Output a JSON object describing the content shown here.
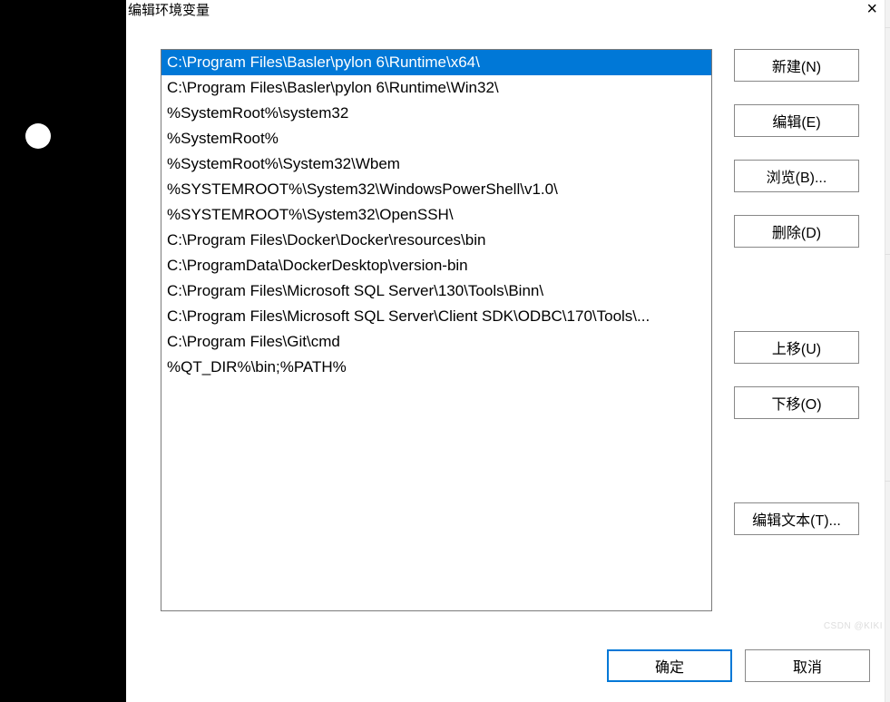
{
  "dialog": {
    "title": "编辑环境变量",
    "close_label": "×"
  },
  "paths": [
    "C:\\Program Files\\Basler\\pylon 6\\Runtime\\x64\\",
    "C:\\Program Files\\Basler\\pylon 6\\Runtime\\Win32\\",
    "%SystemRoot%\\system32",
    "%SystemRoot%",
    "%SystemRoot%\\System32\\Wbem",
    "%SYSTEMROOT%\\System32\\WindowsPowerShell\\v1.0\\",
    "%SYSTEMROOT%\\System32\\OpenSSH\\",
    "C:\\Program Files\\Docker\\Docker\\resources\\bin",
    "C:\\ProgramData\\DockerDesktop\\version-bin",
    "C:\\Program Files\\Microsoft SQL Server\\130\\Tools\\Binn\\",
    "C:\\Program Files\\Microsoft SQL Server\\Client SDK\\ODBC\\170\\Tools\\...",
    "C:\\Program Files\\Git\\cmd",
    "%QT_DIR%\\bin;%PATH%"
  ],
  "selected_index": 0,
  "buttons": {
    "new": "新建(N)",
    "edit": "编辑(E)",
    "browse": "浏览(B)...",
    "delete": "删除(D)",
    "move_up": "上移(U)",
    "move_down": "下移(O)",
    "edit_text": "编辑文本(T)...",
    "ok": "确定",
    "cancel": "取消"
  },
  "watermark": "CSDN @KIKI"
}
